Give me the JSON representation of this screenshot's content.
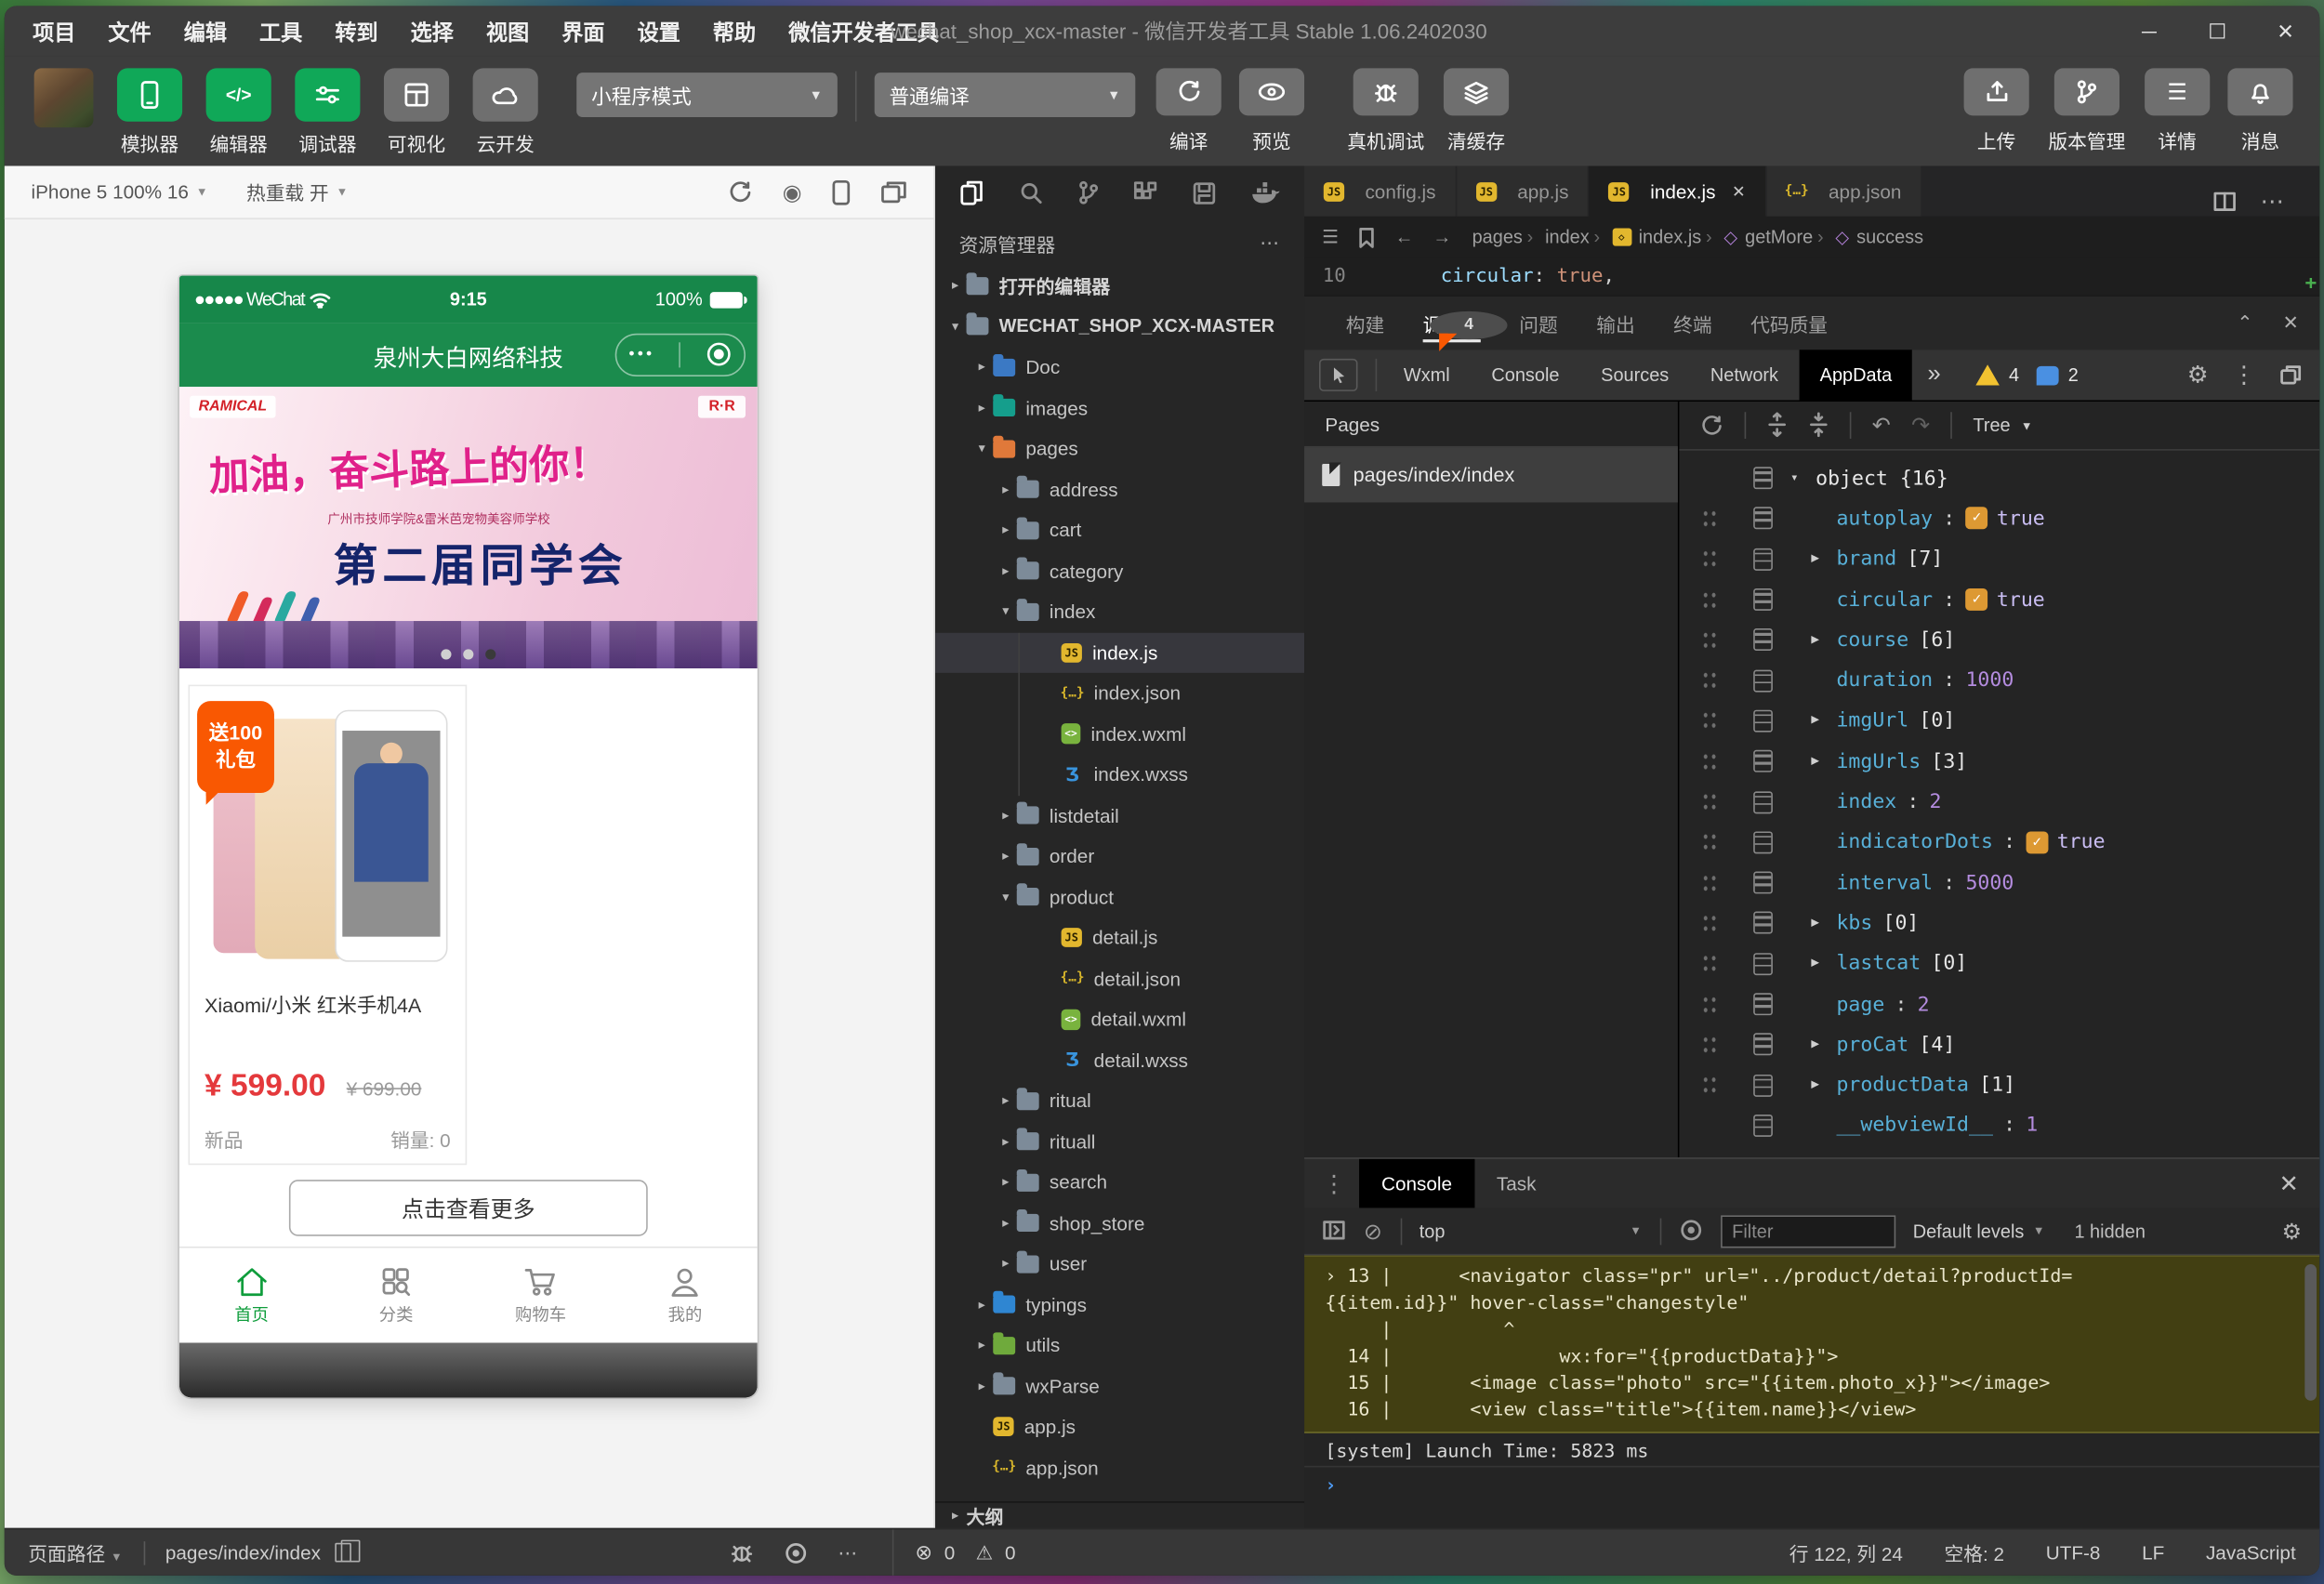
{
  "window": {
    "menus": [
      {
        "label": "项目"
      },
      {
        "label": "文件"
      },
      {
        "label": "编辑"
      },
      {
        "label": "工具"
      },
      {
        "label": "转到"
      },
      {
        "label": "选择"
      },
      {
        "label": "视图"
      },
      {
        "label": "界面"
      },
      {
        "label": "设置"
      },
      {
        "label": "帮助"
      },
      {
        "label": "微信开发者工具"
      }
    ],
    "title": "wechat_shop_xcx-master - 微信开发者工具 Stable 1.06.2402030",
    "minimize": "─",
    "maximize": "☐",
    "close": "✕"
  },
  "toolbar": {
    "sim_buttons": {
      "simulator": "模拟器",
      "editor": "编辑器",
      "debugger": "调试器",
      "visual": "可视化",
      "cloud": "云开发"
    },
    "mode_dropdown": "小程序模式",
    "compile_dropdown": "普通编译",
    "actions": {
      "compile": "编译",
      "preview": "预览",
      "remote_debug": "真机调试",
      "clear_cache": "清缓存"
    },
    "right": {
      "upload": "上传",
      "version": "版本管理",
      "detail": "详情",
      "message": "消息"
    }
  },
  "simulator": {
    "device": "iPhone 5 100% 16",
    "hot_reload": "热重载 开",
    "phone": {
      "carrier": "●●●●● WeChat",
      "time": "9:15",
      "battery": "100%",
      "nav_title": "泉州大白网络科技",
      "capsule_dots": "•••",
      "banner": {
        "logo": "RAMICAL",
        "logo2": "R·R",
        "slogan": "加油，奋斗路上的你！",
        "subtitle": "广州市技师学院&雷米芭宠物美容师学校",
        "event": "第二届同学会"
      },
      "product": {
        "badge_line1": "送100",
        "badge_line2": "礼包",
        "title": "Xiaomi/小米 红米手机4A",
        "price": "¥ 599.00",
        "old_price": "¥ 699.00",
        "tag": "新品",
        "sales": "销量: 0"
      },
      "more_button": "点击查看更多",
      "tabbar": {
        "home": "首页",
        "category": "分类",
        "cart": "购物车",
        "mine": "我的"
      }
    }
  },
  "explorer": {
    "header": "资源管理器",
    "more": "⋯",
    "tree": [
      {
        "label": "打开的编辑器",
        "cls": "sect",
        "arrow": "▸"
      },
      {
        "label": "WECHAT_SHOP_XCX-MASTER",
        "cls": "sect",
        "arrow": "▾"
      },
      {
        "label": "Doc",
        "cls": "in1 f-blue",
        "arrow": "▸"
      },
      {
        "label": "images",
        "cls": "in1 f-teal",
        "arrow": "▸"
      },
      {
        "label": "pages",
        "cls": "in1 f-orange",
        "arrow": "▾"
      },
      {
        "label": "address",
        "cls": "in2",
        "arrow": "▸"
      },
      {
        "label": "cart",
        "cls": "in2",
        "arrow": "▸"
      },
      {
        "label": "category",
        "cls": "in2",
        "arrow": "▸"
      },
      {
        "label": "index",
        "cls": "in2",
        "arrow": "▾"
      },
      {
        "label": "index.js",
        "cls": "in3 icon-js sel guide",
        "arrow": ""
      },
      {
        "label": "index.json",
        "cls": "in3 icon-json guide",
        "arrow": ""
      },
      {
        "label": "index.wxml",
        "cls": "in3 icon-wxml guide",
        "arrow": ""
      },
      {
        "label": "index.wxss",
        "cls": "in3 icon-wxss guide",
        "arrow": ""
      },
      {
        "label": "listdetail",
        "cls": "in2",
        "arrow": "▸"
      },
      {
        "label": "order",
        "cls": "in2",
        "arrow": "▸"
      },
      {
        "label": "product",
        "cls": "in2",
        "arrow": "▾"
      },
      {
        "label": "detail.js",
        "cls": "in3 icon-js",
        "arrow": ""
      },
      {
        "label": "detail.json",
        "cls": "in3 icon-json",
        "arrow": ""
      },
      {
        "label": "detail.wxml",
        "cls": "in3 icon-wxml",
        "arrow": ""
      },
      {
        "label": "detail.wxss",
        "cls": "in3 icon-wxss",
        "arrow": ""
      },
      {
        "label": "ritual",
        "cls": "in2",
        "arrow": "▸"
      },
      {
        "label": "rituall",
        "cls": "in2",
        "arrow": "▸"
      },
      {
        "label": "search",
        "cls": "in2",
        "arrow": "▸"
      },
      {
        "label": "shop_store",
        "cls": "in2",
        "arrow": "▸"
      },
      {
        "label": "user",
        "cls": "in2",
        "arrow": "▸"
      },
      {
        "label": "typings",
        "cls": "in1 f-ts",
        "arrow": "▸"
      },
      {
        "label": "utils",
        "cls": "in1 f-green",
        "arrow": "▸"
      },
      {
        "label": "wxParse",
        "cls": "in1",
        "arrow": "▸"
      },
      {
        "label": "app.js",
        "cls": "in1 icon-js",
        "arrow": ""
      },
      {
        "label": "app.json",
        "cls": "in1 icon-json",
        "arrow": ""
      }
    ],
    "outline": "大纲"
  },
  "editor": {
    "tabs": [
      {
        "label": "config.js",
        "cls": "icon-js",
        "close": ""
      },
      {
        "label": "app.js",
        "cls": "icon-js",
        "close": ""
      },
      {
        "label": "index.js",
        "cls": "icon-js active",
        "close": "✕"
      },
      {
        "label": "app.json",
        "cls": "icon-json",
        "close": ""
      }
    ],
    "breadcrumb": [
      {
        "label": "pages",
        "cls": ""
      },
      {
        "label": "index",
        "cls": ""
      },
      {
        "label": "index.js",
        "cls": "bc-js"
      },
      {
        "label": "getMore",
        "cls": "bc-sym"
      },
      {
        "label": "success",
        "cls": "bc-sym"
      }
    ],
    "code": {
      "line_no": "10",
      "key": "circular",
      "punct": ": ",
      "value": "true",
      "comma": ","
    }
  },
  "panel": {
    "tabs": [
      {
        "label": "构建",
        "cls": "",
        "badge": ""
      },
      {
        "label": "调试器",
        "cls": "active",
        "badge": "4"
      },
      {
        "label": "问题",
        "cls": "",
        "badge": ""
      },
      {
        "label": "输出",
        "cls": "",
        "badge": ""
      },
      {
        "label": "终端",
        "cls": "",
        "badge": ""
      },
      {
        "label": "代码质量",
        "cls": "",
        "badge": ""
      }
    ],
    "collapse": "⌃",
    "close": "✕",
    "devtools_tabs": [
      {
        "label": "Wxml",
        "cls": ""
      },
      {
        "label": "Console",
        "cls": ""
      },
      {
        "label": "Sources",
        "cls": ""
      },
      {
        "label": "Network",
        "cls": ""
      },
      {
        "label": "AppData",
        "cls": "active"
      }
    ],
    "more_tabs": "»",
    "warn_count": "4",
    "msg_count": "2"
  },
  "appdata": {
    "pages_header": "Pages",
    "page_item": "pages/index/index",
    "undo": "↶",
    "redo": "↷",
    "tree_mode": "Tree",
    "root": {
      "arrow": "▾",
      "label": "object {16}"
    },
    "entries": [
      {
        "key": "autoplay",
        "value": "true",
        "cls": "bool",
        "arrow": ""
      },
      {
        "key": "brand",
        "value": "[7]",
        "cls": "arr",
        "arrow": "▶"
      },
      {
        "key": "circular",
        "value": "true",
        "cls": "bool",
        "arrow": ""
      },
      {
        "key": "course",
        "value": "[6]",
        "cls": "arr",
        "arrow": "▶"
      },
      {
        "key": "duration",
        "value": "1000",
        "cls": "num",
        "arrow": ""
      },
      {
        "key": "imgUrl",
        "value": "[0]",
        "cls": "arr",
        "arrow": "▶"
      },
      {
        "key": "imgUrls",
        "value": "[3]",
        "cls": "arr",
        "arrow": "▶"
      },
      {
        "key": "index",
        "value": "2",
        "cls": "num",
        "arrow": ""
      },
      {
        "key": "indicatorDots",
        "value": "true",
        "cls": "bool",
        "arrow": ""
      },
      {
        "key": "interval",
        "value": "5000",
        "cls": "num",
        "arrow": ""
      },
      {
        "key": "kbs",
        "value": "[0]",
        "cls": "arr",
        "arrow": "▶"
      },
      {
        "key": "lastcat",
        "value": "[0]",
        "cls": "arr",
        "arrow": "▶"
      },
      {
        "key": "page",
        "value": "2",
        "cls": "num",
        "arrow": ""
      },
      {
        "key": "proCat",
        "value": "[4]",
        "cls": "arr",
        "arrow": "▶"
      },
      {
        "key": "productData",
        "value": "[1]",
        "cls": "arr",
        "arrow": "▶"
      },
      {
        "key": "__webviewId__",
        "value": "1",
        "cls": "num nohandle",
        "arrow": ""
      }
    ]
  },
  "console_panel": {
    "grip": "⋮",
    "tabs": [
      {
        "label": "Console",
        "cls": "active"
      },
      {
        "label": "Task",
        "cls": ""
      }
    ],
    "close": "✕",
    "context": "top",
    "filter_placeholder": "Filter",
    "levels": "Default levels",
    "hidden": "1 hidden",
    "warn_lines": [
      {
        "t": "› 13 |      <navigator class=\"pr\" url=\"../product/detail?productId="
      },
      {
        "t": "{{item.id}}\" hover-class=\"changestyle\""
      },
      {
        "t": "     |          ^"
      },
      {
        "t": "  14 |               wx:for=\"{{productData}}\">"
      },
      {
        "t": "  15 |       <image class=\"photo\" src=\"{{item.photo_x}}\"></image>"
      },
      {
        "t": "  16 |       <view class=\"title\">{{item.name}}</view>"
      }
    ],
    "system_line": "[system] Launch Time: 5823 ms",
    "prompt": "›"
  },
  "statusbar": {
    "path_label": "页面路径",
    "path": "pages/index/index",
    "errors": "0",
    "warnings": "0",
    "warn_glyph": "⚠",
    "err_glyph": "⊗",
    "line_col": "行 122, 列 24",
    "spaces": "空格: 2",
    "encoding": "UTF-8",
    "eol": "LF",
    "language": "JavaScript"
  }
}
